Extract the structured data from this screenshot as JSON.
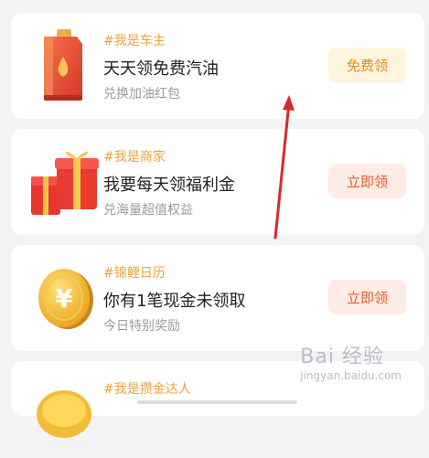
{
  "cards": [
    {
      "tag": "#我是车主",
      "title": "天天领免费汽油",
      "subtitle": "兑换加油红包",
      "button": "免费领",
      "icon": "fuel-can-icon"
    },
    {
      "tag": "#我是商家",
      "title": "我要每天领福利金",
      "subtitle": "兑海量超值权益",
      "button": "立即领",
      "icon": "gift-box-icon"
    },
    {
      "tag": "#锦鲤日历",
      "title": "你有1笔现金未领取",
      "subtitle": "今日特别奖励",
      "button": "立即领",
      "icon": "gold-coin-icon"
    },
    {
      "tag": "#我是攒金达人",
      "icon": "gold-coin-icon"
    }
  ],
  "watermark": {
    "text": "Bai 经验",
    "sub": "jingyan.baidu.com"
  },
  "colors": {
    "tag": "#f0a23c",
    "button_yellow_bg": "#fff4dd",
    "button_yellow_text": "#e28a1c",
    "button_pink_bg": "#ffece4",
    "button_pink_text": "#e35a2a",
    "arrow": "#d8282f"
  }
}
